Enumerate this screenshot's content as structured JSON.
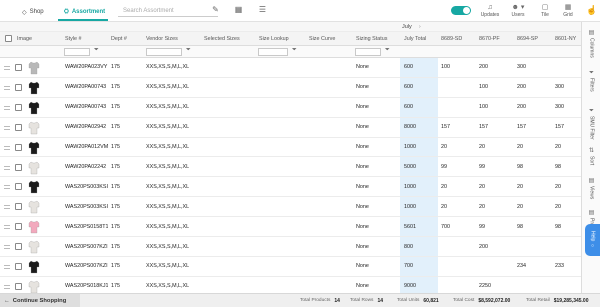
{
  "nav": {
    "shop_label": "Shop",
    "assortment_label": "Assortment",
    "search_placeholder": "Search Assortment",
    "updates_label": "Updates",
    "users_label": "Users",
    "tile_label": "Tile",
    "grid_label": "Grid"
  },
  "grid": {
    "month_label": "July",
    "headers": [
      "Image",
      "Style #",
      "Dept #",
      "Vendor Sizes",
      "Selected Sizes",
      "Size Lookup",
      "Size Curve",
      "Sizing Status",
      "July Total",
      "8689-SD",
      "8670-PF",
      "8694-SP",
      "8601-NY"
    ],
    "rows": [
      {
        "thumb": "grey-knit",
        "style": "WAW20PA023VY",
        "dept": "175",
        "sizes": "XXS,XS,S,M,L,XL",
        "status": "None",
        "total": "600",
        "c1": "100",
        "c2": "200",
        "c3": "300",
        "c4": ""
      },
      {
        "thumb": "black-top",
        "style": "WAW20PA00743",
        "dept": "175",
        "sizes": "XXS,XS,S,M,L,XL",
        "status": "None",
        "total": "600",
        "c1": "",
        "c2": "100",
        "c3": "200",
        "c4": "300"
      },
      {
        "thumb": "black-top",
        "style": "WAW20PA00743",
        "dept": "175",
        "sizes": "XXS,XS,S,M,L,XL",
        "status": "None",
        "total": "600",
        "c1": "",
        "c2": "100",
        "c3": "200",
        "c4": "300"
      },
      {
        "thumb": "light-top",
        "style": "WAW20PA02942",
        "dept": "175",
        "sizes": "XXS,XS,S,M,L,XL",
        "status": "None",
        "total": "8000",
        "c1": "157",
        "c2": "157",
        "c3": "157",
        "c4": "157"
      },
      {
        "thumb": "black-top",
        "style": "WAW20PA012VM",
        "dept": "175",
        "sizes": "XXS,XS,S,M,L,XL",
        "status": "None",
        "total": "1000",
        "c1": "20",
        "c2": "20",
        "c3": "20",
        "c4": "20"
      },
      {
        "thumb": "light-top",
        "style": "WAW20PA02242",
        "dept": "175",
        "sizes": "XXS,XS,S,M,L,XL",
        "status": "None",
        "total": "5000",
        "c1": "99",
        "c2": "99",
        "c3": "98",
        "c4": "98"
      },
      {
        "thumb": "black-top",
        "style": "WAS20PS003KSI",
        "dept": "175",
        "sizes": "XXS,XS,S,M,L,XL",
        "status": "None",
        "total": "1000",
        "c1": "20",
        "c2": "20",
        "c3": "20",
        "c4": "20"
      },
      {
        "thumb": "light-top",
        "style": "WAS20PS003KSI",
        "dept": "175",
        "sizes": "XXS,XS,S,M,L,XL",
        "status": "None",
        "total": "1000",
        "c1": "20",
        "c2": "20",
        "c3": "20",
        "c4": "20"
      },
      {
        "thumb": "pink-top",
        "style": "WAS20PS0158T1",
        "dept": "175",
        "sizes": "XXS,XS,S,M,L,XL",
        "status": "None",
        "total": "5601",
        "c1": "700",
        "c2": "99",
        "c3": "98",
        "c4": "98"
      },
      {
        "thumb": "light-top",
        "style": "WAS20PS007KZI",
        "dept": "175",
        "sizes": "XXS,XS,S,M,L,XL",
        "status": "None",
        "total": "800",
        "c1": "",
        "c2": "200",
        "c3": "",
        "c4": ""
      },
      {
        "thumb": "black-top",
        "style": "WAS20PS007KZI",
        "dept": "175",
        "sizes": "XXS,XS,S,M,L,XL",
        "status": "None",
        "total": "700",
        "c1": "",
        "c2": "",
        "c3": "234",
        "c4": "233"
      },
      {
        "thumb": "light-top",
        "style": "WAS20PS018KJ1",
        "dept": "175",
        "sizes": "XXS,XS,S,M,L,XL",
        "status": "None",
        "total": "9000",
        "c1": "",
        "c2": "2250",
        "c3": "",
        "c4": ""
      }
    ]
  },
  "side_panel": [
    "Columns",
    "Filters",
    "SMU Filter",
    "Sort",
    "Views",
    "Product"
  ],
  "help_label": "Help",
  "footer": {
    "continue_label": "Continue Shopping",
    "total_products_label": "Total Products",
    "total_products": "14",
    "total_rows_label": "Total Rows",
    "total_rows": "14",
    "total_units_label": "Total Units",
    "total_units": "60,821",
    "total_cost_label": "Total Cost",
    "total_cost": "$8,592,072.00",
    "total_retail_label": "Total Retail",
    "total_retail": "$19,285,345.00"
  },
  "colors": {
    "accent": "#17a8a3",
    "july_highlight": "#e2f0fb",
    "help_blue": "#3d8ee8"
  }
}
